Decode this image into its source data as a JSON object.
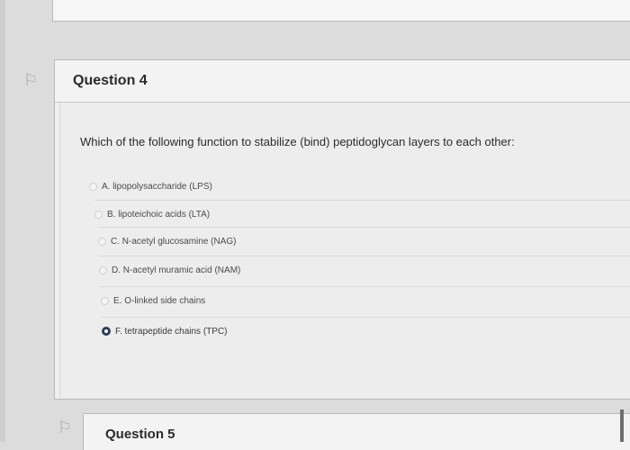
{
  "question4": {
    "title": "Question 4",
    "prompt": "Which of the following function to stabilize (bind) peptidoglycan layers to each other:",
    "options": [
      {
        "label": "A. lipopolysaccharide (LPS)",
        "selected": false
      },
      {
        "label": "B. lipoteichoic acids (LTA)",
        "selected": false
      },
      {
        "label": "C. N-acetyl glucosamine (NAG)",
        "selected": false
      },
      {
        "label": "D. N-acetyl muramic acid (NAM)",
        "selected": false
      },
      {
        "label": "E. O-linked side chains",
        "selected": false
      },
      {
        "label": "F. tetrapeptide chains (TPC)",
        "selected": true
      }
    ]
  },
  "question5": {
    "title": "Question 5"
  },
  "icons": {
    "flag": "flag-icon",
    "radio": "radio-icon"
  },
  "colors": {
    "selected_radio": "#2d3e55",
    "background": "#dcdcdc",
    "card": "#efefef"
  }
}
